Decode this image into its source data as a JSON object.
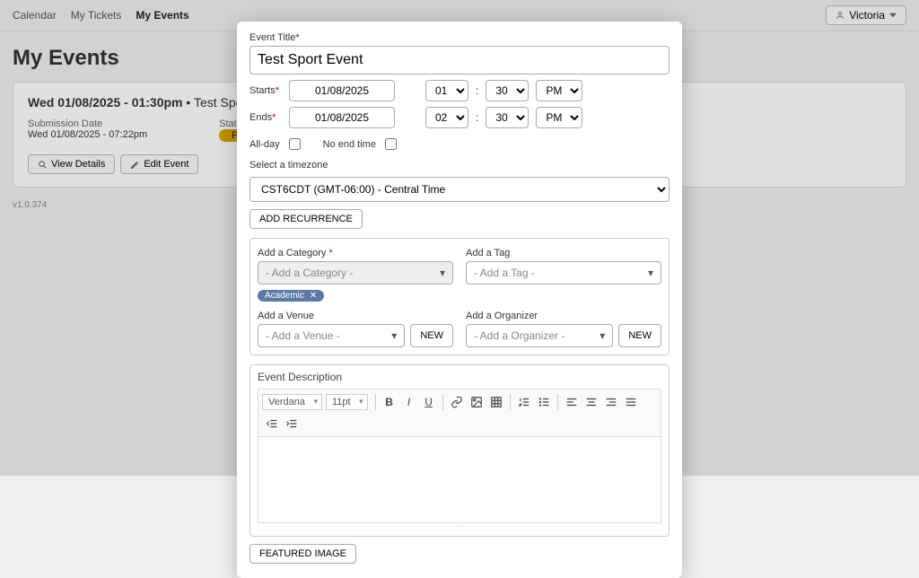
{
  "nav": {
    "calendar": "Calendar",
    "my_tickets": "My Tickets",
    "my_events": "My Events"
  },
  "user": {
    "name": "Victoria"
  },
  "page_title": "My Events",
  "card": {
    "date_time": "Wed 01/08/2025 - 01:30pm",
    "event_name": "Test Sport Event",
    "submission_label": "Submission Date",
    "submission_value": "Wed 01/08/2025 - 07:22pm",
    "status_label": "Status",
    "status_value": "Pending",
    "view_details": "View Details",
    "edit_event": "Edit Event"
  },
  "version": "v1.0.374",
  "modal": {
    "title_label": "Event Title*",
    "title_value": "Test Sport Event",
    "starts_label": "Starts",
    "ends_label": "Ends",
    "start_date": "01/08/2025",
    "end_date": "01/08/2025",
    "start_hour": "01",
    "end_hour": "02",
    "minute": "30",
    "ampm": "PM",
    "colon": ":",
    "all_day": "All-day",
    "no_end": "No end time",
    "tz_label": "Select a timezone",
    "tz_value": "CST6CDT (GMT-06:00) - Central Time",
    "add_recurrence": "ADD RECURRENCE",
    "category_label": "Add a Category",
    "category_placeholder": "- Add a Category -",
    "category_chip": "Academic",
    "tag_label": "Add a Tag",
    "tag_placeholder": "- Add a Tag -",
    "venue_label": "Add a Venue",
    "venue_placeholder": "- Add a Venue -",
    "organizer_label": "Add a Organizer",
    "organizer_placeholder": "- Add a Organizer -",
    "new_btn": "NEW",
    "desc_label": "Event Description",
    "font_name": "Verdana",
    "font_size": "11pt",
    "featured_image": "FEATURED IMAGE"
  }
}
